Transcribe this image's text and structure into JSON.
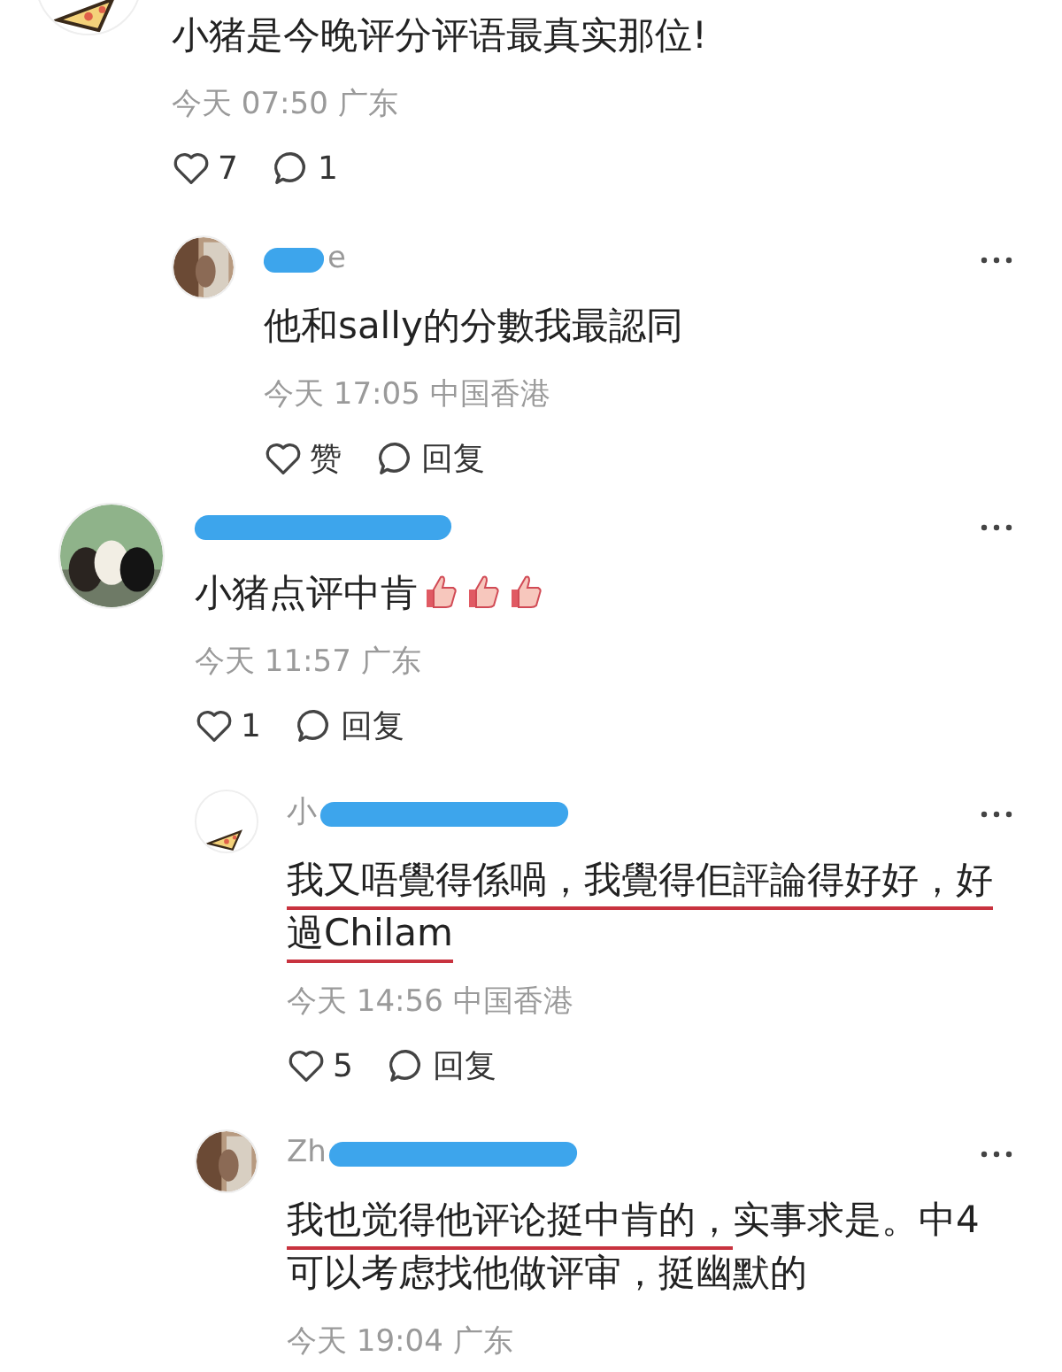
{
  "comments": [
    {
      "avatar": {
        "kind": "picture"
      },
      "text": [
        {
          "text": "小猪是今晚评分评语最真实那位!",
          "underlined": false
        }
      ],
      "time": "今天 07:50 广东",
      "actions": {
        "like": "7",
        "reply": "1"
      },
      "children": [
        {
          "avatar": {
            "kind": "picture"
          },
          "name": [
            {
              "kind": "scribble"
            },
            {
              "kind": "text",
              "text": "e"
            }
          ],
          "text": [
            {
              "text": "他和sally的分數我最認同",
              "underlined": false
            }
          ],
          "time": "今天 17:05 中国香港",
          "actions": {
            "like": "赞",
            "reply": "回复"
          }
        }
      ]
    },
    {
      "avatar": {
        "kind": "picture"
      },
      "name": [
        {
          "kind": "scribble"
        }
      ],
      "text": [
        {
          "text": "小猪点评中肯",
          "underlined": false
        }
      ],
      "stickers": [
        {
          "kind": "thumb"
        },
        {
          "kind": "thumb"
        },
        {
          "kind": "thumb"
        }
      ],
      "time": "今天 11:57 广东",
      "actions": {
        "like": "1",
        "reply": "回复"
      },
      "children": [
        {
          "avatar": {
            "kind": "picture"
          },
          "name": [
            {
              "kind": "text",
              "text": "小"
            },
            {
              "kind": "scribble"
            }
          ],
          "text": [
            {
              "text": "我又唔覺得係喎，我覺得佢評論得好好，好過Chilam",
              "underlined": true
            }
          ],
          "time": "今天 14:56 中国香港",
          "actions": {
            "like": "5",
            "reply": "回复"
          }
        },
        {
          "avatar": {
            "kind": "picture"
          },
          "name": [
            {
              "kind": "text",
              "text": "Zh"
            },
            {
              "kind": "scribble"
            }
          ],
          "text": [
            {
              "text": "我也觉得他评论挺中肯的，",
              "underlined": true
            },
            {
              "text": "实事求是。中4可以考虑找他做评审，挺幽默的",
              "underlined": false
            }
          ],
          "time": "今天 19:04 广东"
        }
      ]
    }
  ]
}
